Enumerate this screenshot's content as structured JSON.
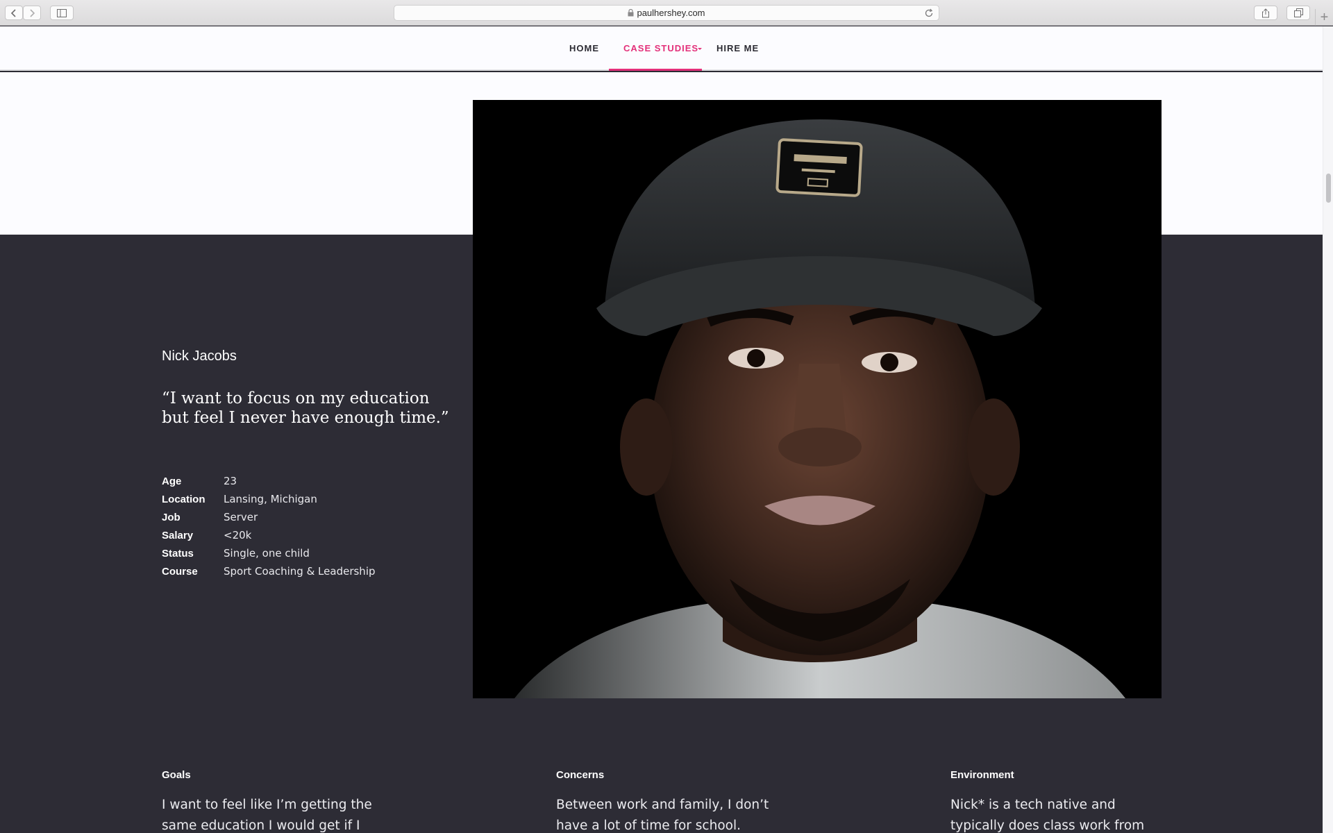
{
  "browser": {
    "url": "paulhershey.com",
    "new_tab_symbol": "+"
  },
  "nav": {
    "items": [
      {
        "label": "HOME",
        "active": false
      },
      {
        "label": "CASE STUDIES",
        "active": true
      },
      {
        "label": "HIRE ME",
        "active": false
      }
    ],
    "accent_color": "#e3307a"
  },
  "persona": {
    "name": "Nick Jacobs",
    "quote": "“I want to focus on my education but feel I never have enough time.”",
    "photo_alt": "Portrait of Nick Jacobs wearing a black cap",
    "facts": [
      {
        "key": "Age",
        "value": "23"
      },
      {
        "key": "Location",
        "value": "Lansing, Michigan"
      },
      {
        "key": "Job",
        "value": "Server"
      },
      {
        "key": "Salary",
        "value": "<20k"
      },
      {
        "key": "Status",
        "value": "Single, one child"
      },
      {
        "key": "Course",
        "value": "Sport Coaching & Leadership"
      }
    ]
  },
  "sections": [
    {
      "title": "Goals",
      "body": "I want to feel like I’m getting the same education I would get if I were on campus. I want to feel"
    },
    {
      "title": "Concerns",
      "body": "Between work and family, I don’t have a lot of time for school. When I sit down to focus on my"
    },
    {
      "title": "Environment",
      "body": "Nick* is a tech native and typically does class work from home in the living room and"
    }
  ]
}
